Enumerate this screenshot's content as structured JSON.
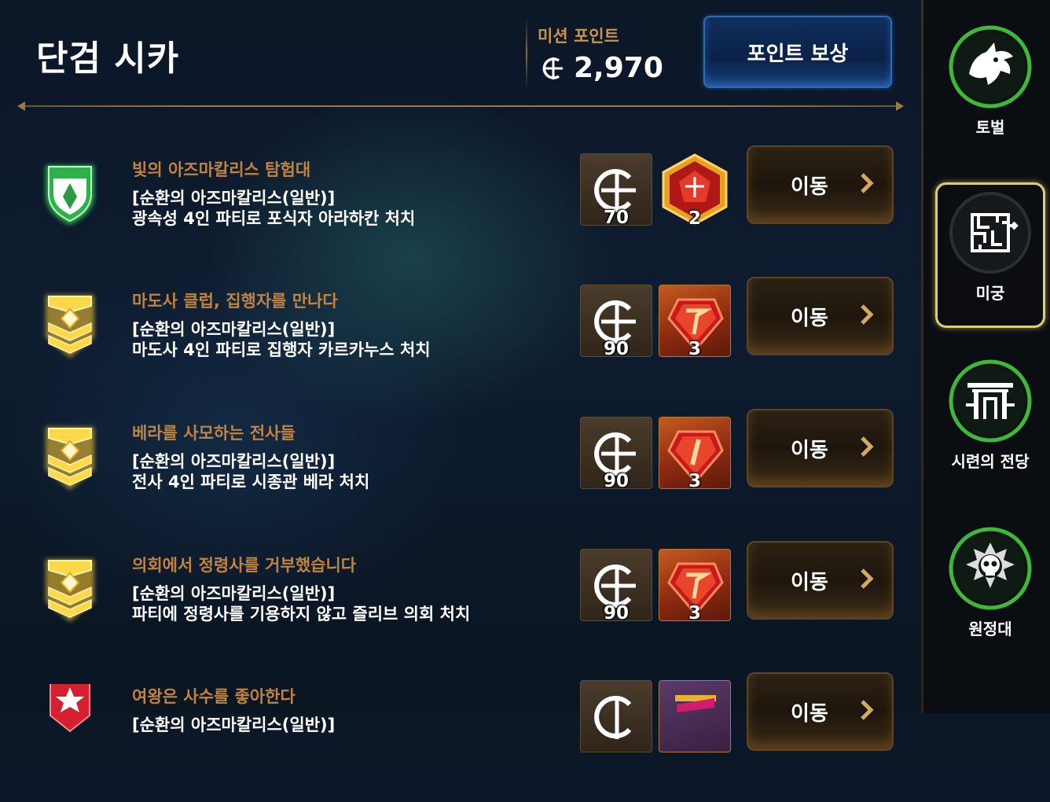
{
  "header": {
    "title": "단검 시카",
    "mission_points_label": "미션 포인트",
    "mission_points_value": "2,970",
    "reward_button": "포인트 보상"
  },
  "missions": [
    {
      "name": "빛의 아즈마칼리스 탐험대",
      "desc1": "[순환의 아즈마칼리스(일반)]",
      "desc2": "광속성 4인 파티로 포식자 아라하칸 처치",
      "emblem": "green-shield-icon",
      "points": "70",
      "gem_count": "2",
      "move_label": "이동"
    },
    {
      "name": "마도사 클럽, 집행자를 만나다",
      "desc1": "[순환의 아즈마칼리스(일반)]",
      "desc2": "마도사 4인 파티로 집행자 카르카누스 처치",
      "emblem": "gold-chevron-icon",
      "points": "90",
      "gem_count": "3",
      "move_label": "이동"
    },
    {
      "name": "베라를 사모하는 전사들",
      "desc1": "[순환의 아즈마칼리스(일반)]",
      "desc2": "전사 4인 파티로 시종관 베라 처치",
      "emblem": "gold-chevron-icon",
      "points": "90",
      "gem_count": "3",
      "move_label": "이동"
    },
    {
      "name": "의회에서 정령사를 거부했습니다",
      "desc1": "[순환의 아즈마칼리스(일반)]",
      "desc2": "파티에 정령사를 기용하지 않고 즐리브 의회 처치",
      "emblem": "gold-chevron-icon",
      "points": "90",
      "gem_count": "3",
      "move_label": "이동"
    },
    {
      "name": "여왕은 사수를 좋아한다",
      "desc1": "[순환의 아즈마칼리스(일반)]",
      "desc2": "",
      "emblem": "red-star-icon",
      "points": "",
      "gem_count": "",
      "move_label": "이동"
    }
  ],
  "sidebar": {
    "items": [
      {
        "label": "토벌",
        "icon": "dragon-icon"
      },
      {
        "label": "미궁",
        "icon": "maze-icon",
        "active": true
      },
      {
        "label": "시련의 전당",
        "icon": "gate-icon"
      },
      {
        "label": "원정대",
        "icon": "skull-icon"
      }
    ]
  },
  "colors": {
    "accent_gold": "#c2833f",
    "button_blue": "#2a6cb8",
    "ring_green": "#3fb83a",
    "active_border": "#d9cf7a"
  }
}
